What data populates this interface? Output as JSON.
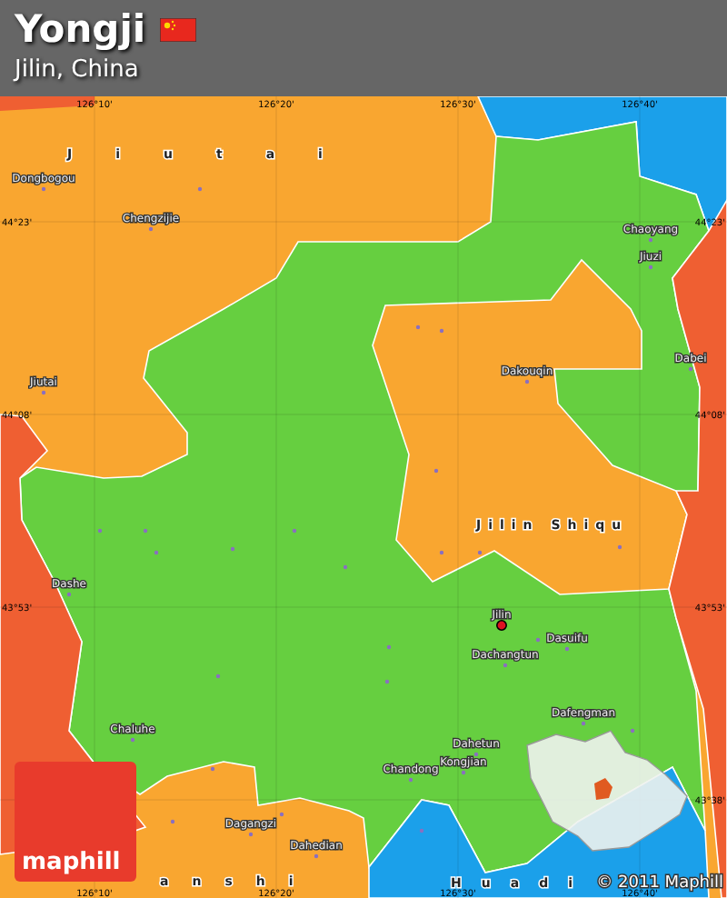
{
  "header": {
    "title": "Yongji",
    "subtitle": "Jilin, China"
  },
  "region_labels": [
    {
      "name": "Jiutai"
    },
    {
      "name": "Jilin Shiqu"
    },
    {
      "name": "anshi"
    },
    {
      "name": "Huadi"
    }
  ],
  "places": [
    {
      "name": "Dongbogou",
      "kind": "town"
    },
    {
      "name": "Chengzijie",
      "kind": "town"
    },
    {
      "name": "Jiutai",
      "kind": "town"
    },
    {
      "name": "Chaoyang",
      "kind": "town"
    },
    {
      "name": "Jiuzi",
      "kind": "town"
    },
    {
      "name": "Dakouqin",
      "kind": "town"
    },
    {
      "name": "Dabei",
      "kind": "town"
    },
    {
      "name": "Dashe",
      "kind": "town"
    },
    {
      "name": "Jilin",
      "kind": "capital"
    },
    {
      "name": "Dasuifu",
      "kind": "town"
    },
    {
      "name": "Dachangtun",
      "kind": "town"
    },
    {
      "name": "Dafengman",
      "kind": "town"
    },
    {
      "name": "Dahetun",
      "kind": "town"
    },
    {
      "name": "Kongjian",
      "kind": "town"
    },
    {
      "name": "Chandong",
      "kind": "town"
    },
    {
      "name": "Chaluhe",
      "kind": "town"
    },
    {
      "name": "Dagangzi",
      "kind": "town"
    },
    {
      "name": "Dahedian",
      "kind": "town"
    }
  ],
  "coordinate_labels": {
    "top": [
      "126°10'",
      "126°20'",
      "126°30'",
      "126°40'"
    ],
    "bottom": [
      "126°10'",
      "126°20'",
      "126°30'",
      "126°40'"
    ],
    "left": [
      "44°23'",
      "44°08'",
      "43°53'"
    ],
    "right": [
      "44°23'",
      "44°08'",
      "43°53'",
      "43°38'"
    ]
  },
  "logo": {
    "text": "maphill"
  },
  "copyright": "© 2011 Maphill"
}
